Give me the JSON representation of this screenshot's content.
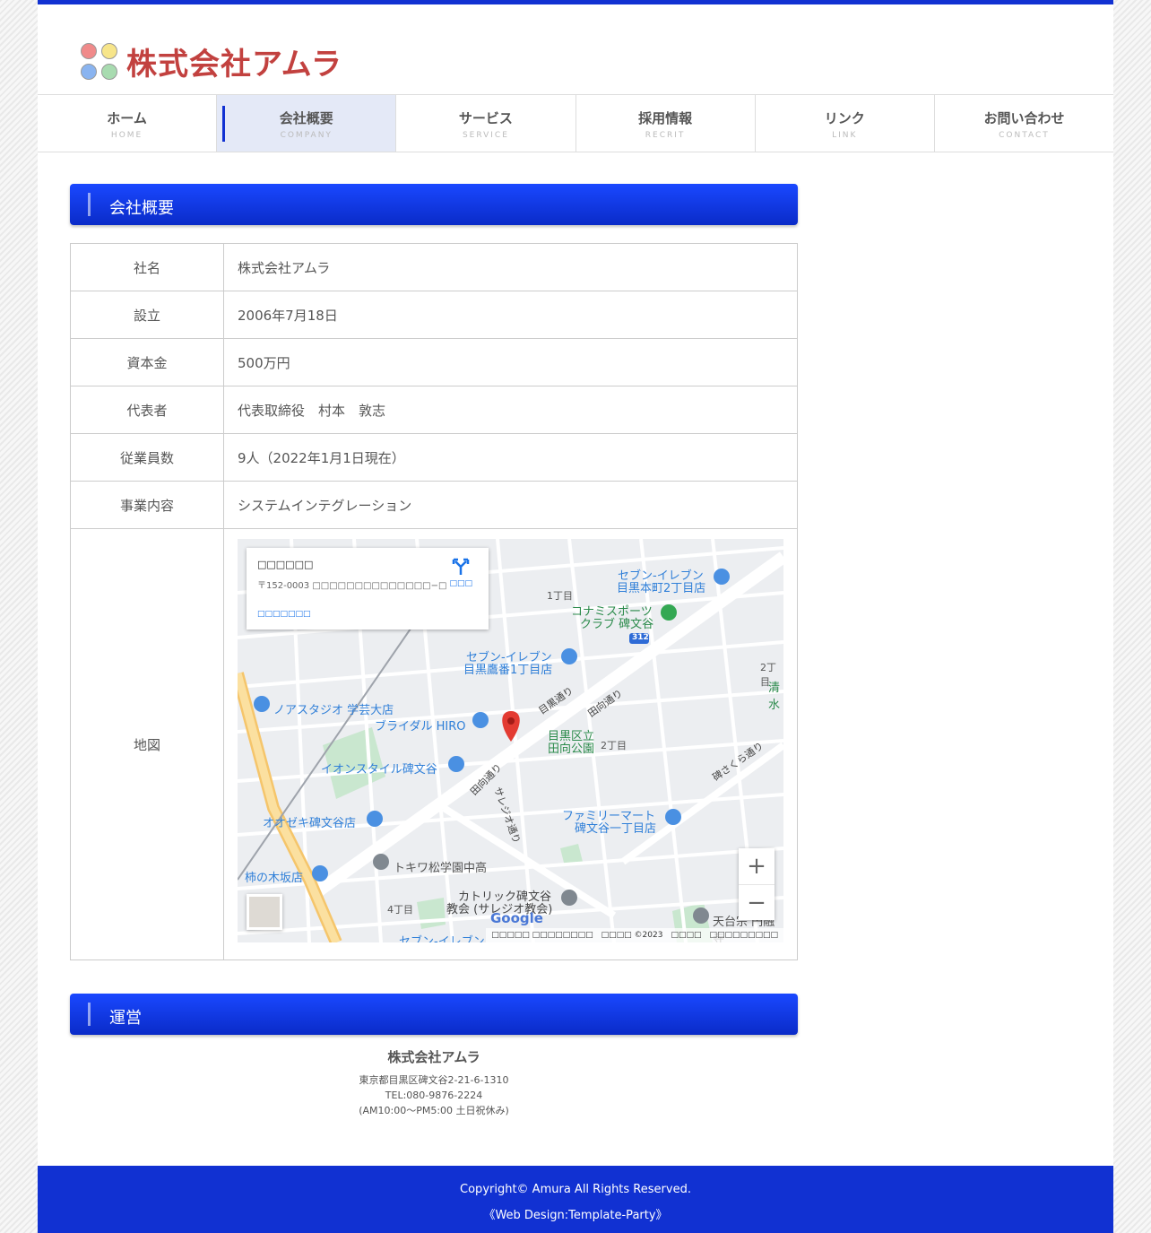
{
  "logo": {
    "text": "株式会社アムラ",
    "dot_colors": [
      "#f08a8a",
      "#f7e58a",
      "#8ab4f0",
      "#a8dbb0"
    ]
  },
  "colors": {
    "accent": "#1131d2",
    "logo_red": "#c2413f"
  },
  "nav": [
    {
      "label": "ホーム",
      "sub": "HOME"
    },
    {
      "label": "会社概要",
      "sub": "COMPANY",
      "active": true
    },
    {
      "label": "サービス",
      "sub": "SERVICE"
    },
    {
      "label": "採用情報",
      "sub": "RECRIT"
    },
    {
      "label": "リンク",
      "sub": "LINK"
    },
    {
      "label": "お問い合わせ",
      "sub": "CONTACT"
    }
  ],
  "section1": {
    "title": "会社概要"
  },
  "info": [
    {
      "key": "社名",
      "value": "株式会社アムラ"
    },
    {
      "key": "設立",
      "value": "2006年7月18日"
    },
    {
      "key": "資本金",
      "value": "500万円"
    },
    {
      "key": "代表者",
      "value": "代表取締役　村本　敦志"
    },
    {
      "key": "従業員数",
      "value": "9人（2022年1月1日現在）"
    },
    {
      "key": "事業内容",
      "value": "システムインテグレーション"
    },
    {
      "key": "地図"
    }
  ],
  "map": {
    "card_title": "□□□□□□",
    "card_address": "〒152-0003 □□□□□□□□□□□□□□−□",
    "card_link": "□□□□□□□",
    "directions": "□□□",
    "copyright": "□□□□□ □□□□□□□□　□□□□ ©2023　□□□□　□□□□□□□□□",
    "google": "Google",
    "labels": [
      "セブン-イレブン",
      "目黒本町2丁目店",
      "1丁目",
      "コナミスポーツ",
      "クラブ 碑文谷",
      "312",
      "セブン-イレブン",
      "目黒鷹番1丁目店",
      "2丁目",
      "清水",
      "ノアスタジオ 学芸大店",
      "目黒通り",
      "田向通り",
      "ブライダル HIRO",
      "目黒区立",
      "田向公園",
      "2丁目",
      "碑さくら通り",
      "イオンスタイル碑文谷",
      "田向通り",
      "サレジオ通り",
      "ファミリーマート",
      "碑文谷一丁目店",
      "オオゼキ碑文谷店",
      "トキワ松学園中高",
      "柿の木坂店",
      "カトリック碑文谷",
      "教会 (サレジオ教会)",
      "4丁目",
      "天台宗 円融寺",
      "セブン-イレブン"
    ]
  },
  "section2": {
    "title": "運営"
  },
  "company": {
    "name": "株式会社アムラ",
    "address": "東京都目黒区碑文谷2-21-6-1310",
    "tel": "TEL:080-9876-2224",
    "hours": "(AM10:00〜PM5:00 土日祝休み)"
  },
  "footer": {
    "copyright": "Copyright© Amura All Rights Reserved.",
    "credit": "《Web Design:Template-Party》"
  }
}
